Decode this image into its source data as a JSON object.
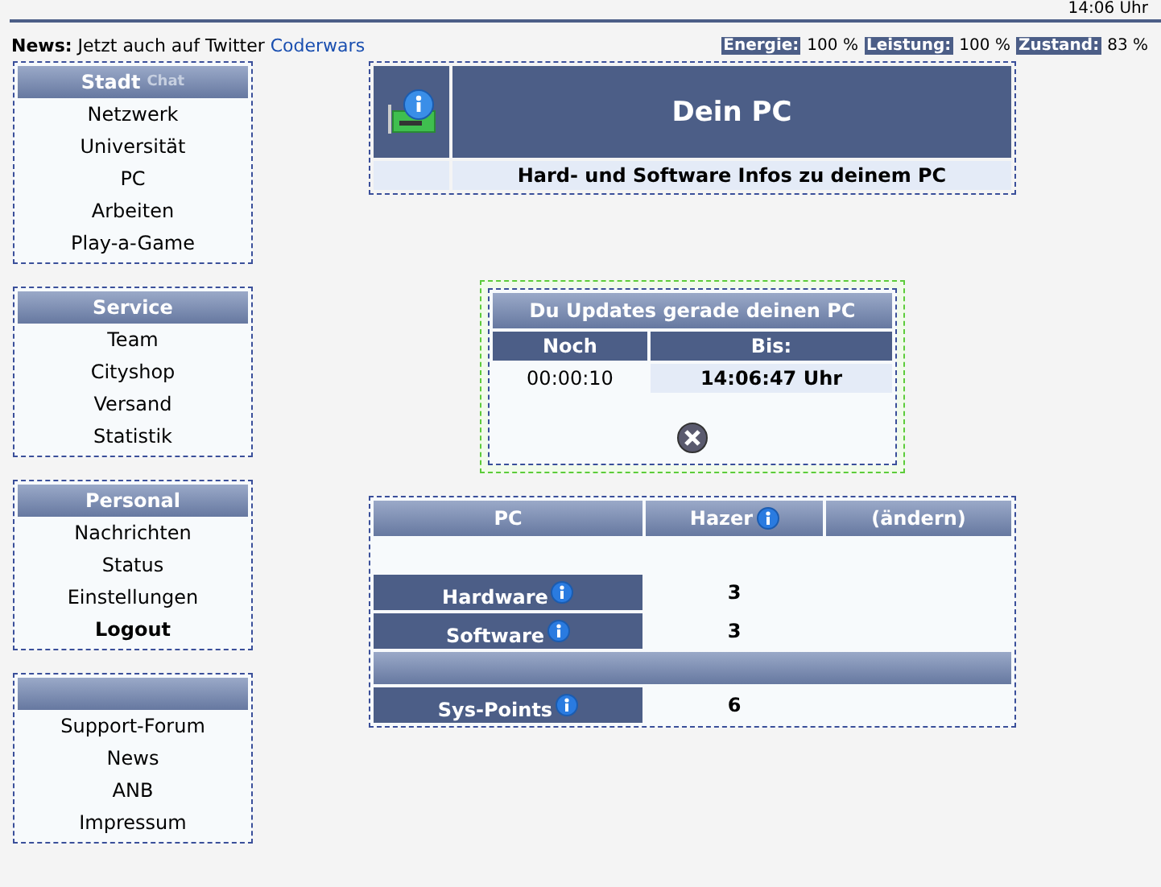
{
  "clock": "14:06 Uhr",
  "news": {
    "label": "News:",
    "text": "Jetzt auch auf Twitter",
    "link": "Coderwars"
  },
  "stats": [
    {
      "label": "Energie:",
      "value": "100 %"
    },
    {
      "label": "Leistung:",
      "value": "100 %"
    },
    {
      "label": "Zustand:",
      "value": "83 %"
    }
  ],
  "sidebar": [
    {
      "title": "Stadt",
      "extra": "Chat",
      "items": [
        {
          "label": "Netzwerk",
          "emphasized": false
        },
        {
          "label": "Universität",
          "emphasized": false
        },
        {
          "label": "PC",
          "emphasized": false
        },
        {
          "label": "Arbeiten",
          "emphasized": false
        },
        {
          "label": "Play-a-Game",
          "emphasized": false
        }
      ]
    },
    {
      "title": "Service",
      "items": [
        {
          "label": "Team",
          "emphasized": false
        },
        {
          "label": "Cityshop",
          "emphasized": false
        },
        {
          "label": "Versand",
          "emphasized": false
        },
        {
          "label": "Statistik",
          "emphasized": false
        }
      ]
    },
    {
      "title": "Personal",
      "items": [
        {
          "label": "Nachrichten",
          "emphasized": false
        },
        {
          "label": "Status",
          "emphasized": false
        },
        {
          "label": "Einstellungen",
          "emphasized": false
        },
        {
          "label": "Logout",
          "emphasized": true
        }
      ]
    },
    {
      "items": [
        {
          "label": "Support-Forum",
          "emphasized": false
        },
        {
          "label": "News",
          "emphasized": false
        },
        {
          "label": "ANB",
          "emphasized": false
        },
        {
          "label": "Impressum",
          "emphasized": false
        }
      ]
    }
  ],
  "page": {
    "title": "Dein PC",
    "subtitle": "Hard- und Software Infos zu deinem PC"
  },
  "update": {
    "title": "Du Updates gerade deinen PC",
    "columns": [
      "Noch",
      "Bis:"
    ],
    "remaining": "00:00:10",
    "until": "14:06:47 Uhr"
  },
  "pc_table": {
    "columns": [
      {
        "label": "PC",
        "info": false
      },
      {
        "label": "Hazer",
        "info": true
      },
      {
        "label": "(ändern)",
        "info": false
      }
    ],
    "rows": [
      {
        "kind": "value",
        "label": "Hardware",
        "value": "3"
      },
      {
        "kind": "value",
        "label": "Software",
        "value": "3"
      },
      {
        "kind": "separator"
      },
      {
        "kind": "value",
        "label": "Sys-Points",
        "value": "6"
      }
    ]
  }
}
